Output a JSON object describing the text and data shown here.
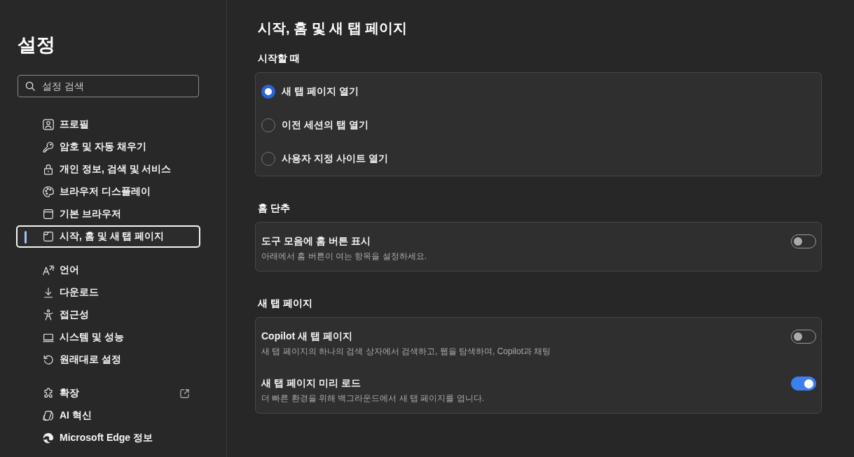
{
  "sidebar": {
    "title": "설정",
    "search": {
      "placeholder": "설정 검색"
    },
    "groups": [
      {
        "items": [
          {
            "label": "프로필",
            "kind": "page",
            "selected": false
          },
          {
            "label": "암호 및 자동 채우기",
            "kind": "page",
            "selected": false
          },
          {
            "label": "개인 정보, 검색 및 서비스",
            "kind": "page",
            "selected": false
          },
          {
            "label": "브라우저 디스플레이",
            "kind": "page",
            "selected": false
          },
          {
            "label": "기본 브라우저",
            "kind": "page",
            "selected": false
          },
          {
            "label": "시작, 홈 및 새 탭 페이지",
            "kind": "page",
            "selected": true
          }
        ]
      },
      {
        "items": [
          {
            "label": "언어",
            "kind": "page",
            "selected": false
          },
          {
            "label": "다운로드",
            "kind": "page",
            "selected": false
          },
          {
            "label": "접근성",
            "kind": "page",
            "selected": false
          },
          {
            "label": "시스템 및 성능",
            "kind": "page",
            "selected": false
          },
          {
            "label": "원래대로 설정",
            "kind": "page",
            "selected": false
          }
        ]
      },
      {
        "items": [
          {
            "label": "확장",
            "kind": "external",
            "selected": false
          },
          {
            "label": "AI 혁신",
            "kind": "page",
            "selected": false
          },
          {
            "label": "Microsoft Edge 정보",
            "kind": "page",
            "selected": false
          }
        ]
      }
    ]
  },
  "page": {
    "title": "시작, 홈 및 새 탭 페이지",
    "sections": [
      {
        "heading": "시작할 때",
        "kind": "radio",
        "options": [
          {
            "label": "새 탭 페이지 열기",
            "selected": true
          },
          {
            "label": "이전 세션의 탭 열기",
            "selected": false
          },
          {
            "label": "사용자 지정 사이트 열기",
            "selected": false
          }
        ]
      },
      {
        "heading": "홈 단추",
        "kind": "toggles",
        "settings": [
          {
            "label": "도구 모음에 홈 버튼 표시",
            "description": "아래에서 홈 버튼이 여는 항목을 설정하세요.",
            "on": false
          }
        ]
      },
      {
        "heading": "새 탭 페이지",
        "kind": "toggles",
        "settings": [
          {
            "label": "Copilot 새 탭 페이지",
            "description": "새 탭 페이지의 하나의 검색 상자에서 검색하고, 웹을 탐색하며, Copilot과 채팅",
            "on": false
          },
          {
            "label": "새 탭 페이지 미리 로드",
            "description": "더 빠른 환경을 위해 백그라운드에서 새 탭 페이지를 엽니다.",
            "on": true
          }
        ]
      }
    ]
  }
}
